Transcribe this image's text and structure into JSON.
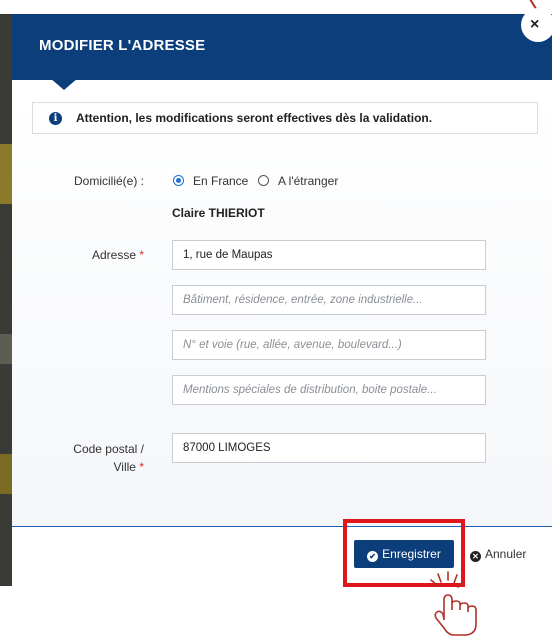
{
  "modal": {
    "title": "MODIFIER L'ADRESSE",
    "close_label": "×"
  },
  "alert": {
    "icon": "info-icon",
    "text": "Attention, les modifications seront effectives dès la validation."
  },
  "form": {
    "domicile_label": "Domicilié(e) :",
    "domicile_options": [
      {
        "label": "En France",
        "checked": true
      },
      {
        "label": "A l'étranger",
        "checked": false
      }
    ],
    "person_name": "Claire THIERIOT",
    "address_label": "Adresse",
    "required_marker": "*",
    "address_line1_value": "1, rue de Maupas",
    "address_line2_placeholder": "Bâtiment, résidence, entrée, zone industrielle...",
    "address_line3_placeholder": "N° et voie (rue, allée, avenue, boulevard...)",
    "address_line4_placeholder": "Mentions spéciales de distribution, boite postale...",
    "postal_label_line1": "Code postal /",
    "postal_label_line2": "Ville",
    "postal_value": "87000 LIMOGES"
  },
  "footer": {
    "save_label": "Enregistrer",
    "cancel_label": "Annuler"
  },
  "colors": {
    "header": "#0c3e7c",
    "required": "#d0302b",
    "radio_checked": "#1f6fd1",
    "highlight": "#e0141b"
  }
}
